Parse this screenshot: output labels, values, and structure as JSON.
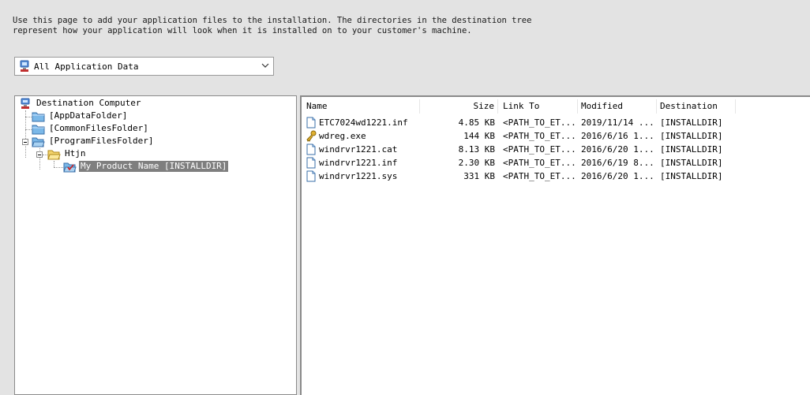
{
  "description": "Use this page to add your application files to the installation. The directories in the destination tree\nrepresent how your application will look when it is installed on to your customer's machine.",
  "filter": {
    "selected": "All Application Data",
    "icon": "installer-computer-icon"
  },
  "tree": {
    "root": "Destination Computer",
    "nodes": [
      {
        "label": "[AppDataFolder]",
        "icon": "folder-icon"
      },
      {
        "label": "[CommonFilesFolder]",
        "icon": "folder-icon"
      },
      {
        "label": "[ProgramFilesFolder]",
        "icon": "folder-open-icon"
      },
      {
        "label": "Htjn",
        "icon": "folder-open-icon"
      },
      {
        "label": "My Product Name [INSTALLDIR]",
        "icon": "component-folder-icon"
      }
    ]
  },
  "list": {
    "columns": [
      "Name",
      "Size",
      "Link To",
      "Modified",
      "Destination"
    ],
    "rows": [
      {
        "name": "ETC7024wd1221.inf",
        "size": "4.85 KB",
        "link": "<PATH_TO_ET...",
        "modified": "2019/11/14 ...",
        "dest": "[INSTALLDIR]",
        "icon": "file-icon"
      },
      {
        "name": "wdreg.exe",
        "size": "144 KB",
        "link": "<PATH_TO_ET...",
        "modified": "2016/6/16 1...",
        "dest": "[INSTALLDIR]",
        "icon": "key-executable-icon"
      },
      {
        "name": "windrvr1221.cat",
        "size": "8.13 KB",
        "link": "<PATH_TO_ET...",
        "modified": "2016/6/20 1...",
        "dest": "[INSTALLDIR]",
        "icon": "file-icon"
      },
      {
        "name": "windrvr1221.inf",
        "size": "2.30 KB",
        "link": "<PATH_TO_ET...",
        "modified": "2016/6/19 8...",
        "dest": "[INSTALLDIR]",
        "icon": "file-icon"
      },
      {
        "name": "windrvr1221.sys",
        "size": "331 KB",
        "link": "<PATH_TO_ET...",
        "modified": "2016/6/20 1...",
        "dest": "[INSTALLDIR]",
        "icon": "file-icon"
      }
    ]
  },
  "colors": {
    "folder": "#7bb8e8",
    "folder_open": "#f2d36b",
    "selection": "#7f7f7f"
  }
}
